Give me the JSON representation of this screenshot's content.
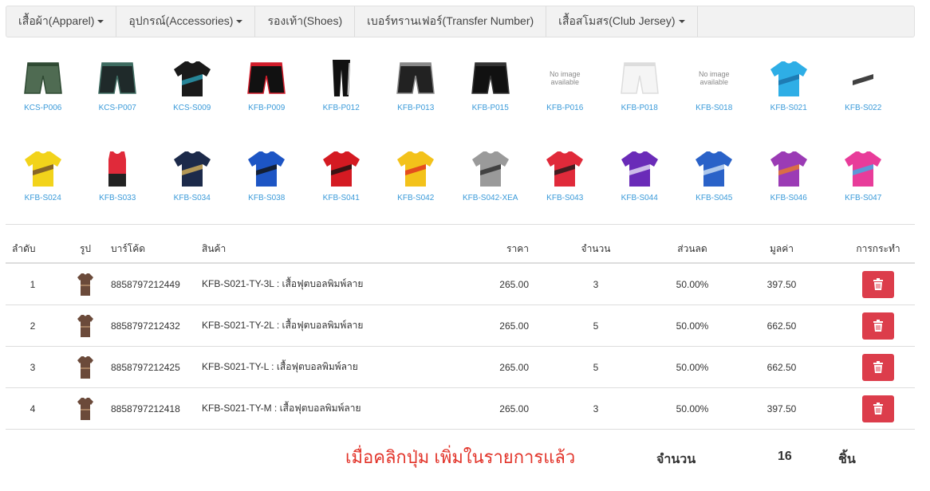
{
  "nav": {
    "items": [
      {
        "label": "เสื้อผ้า(Apparel)",
        "dropdown": true
      },
      {
        "label": "อุปกรณ์(Accessories)",
        "dropdown": true
      },
      {
        "label": "รองเท้า(Shoes)",
        "dropdown": false
      },
      {
        "label": "เบอร์ทรานเฟอร์(Transfer Number)",
        "dropdown": false
      },
      {
        "label": "เสื้อสโมสร(Club Jersey)",
        "dropdown": true
      }
    ]
  },
  "no_image_text": "No image available",
  "products_row1": [
    {
      "code": "KCS-P006",
      "kind": "shorts",
      "color": "#4f6b52",
      "accent": "#2f4a33"
    },
    {
      "code": "KCS-P007",
      "kind": "shorts",
      "color": "#1f2a2a",
      "accent": "#3d6b60"
    },
    {
      "code": "KCS-S009",
      "kind": "shirt",
      "color": "#1a1a1a",
      "accent": "#2aa0b8"
    },
    {
      "code": "KFB-P009",
      "kind": "shorts",
      "color": "#111111",
      "accent": "#d01c2a"
    },
    {
      "code": "KFB-P012",
      "kind": "pants",
      "color": "#111111",
      "accent": "#ffffff"
    },
    {
      "code": "KFB-P013",
      "kind": "shorts",
      "color": "#222222",
      "accent": "#888888"
    },
    {
      "code": "KFB-P015",
      "kind": "shorts",
      "color": "#111111",
      "accent": "#333333"
    },
    {
      "code": "KFB-P016",
      "kind": "none",
      "color": "",
      "accent": ""
    },
    {
      "code": "KFB-P018",
      "kind": "shorts",
      "color": "#f5f5f5",
      "accent": "#dddddd"
    },
    {
      "code": "KFB-S018",
      "kind": "none",
      "color": "",
      "accent": ""
    },
    {
      "code": "KFB-S021",
      "kind": "shirt",
      "color": "#2eaee6",
      "accent": "#1a6fa8"
    },
    {
      "code": "KFB-S022",
      "kind": "shirt",
      "color": "#ffffff",
      "accent": "#111111"
    }
  ],
  "products_row2": [
    {
      "code": "KFB-S024",
      "kind": "shirt",
      "color": "#f2d31b",
      "accent": "#6b4a2a"
    },
    {
      "code": "KFB-S033",
      "kind": "tank",
      "color": "#e02a3a",
      "accent": "#222222"
    },
    {
      "code": "KFB-S034",
      "kind": "shirt",
      "color": "#1c2a4a",
      "accent": "#d9b45a"
    },
    {
      "code": "KFB-S038",
      "kind": "shirt",
      "color": "#1d55c4",
      "accent": "#111111"
    },
    {
      "code": "KFB-S041",
      "kind": "shirt",
      "color": "#d41a22",
      "accent": "#111111"
    },
    {
      "code": "KFB-S042",
      "kind": "shirt",
      "color": "#f3c21a",
      "accent": "#e0301e"
    },
    {
      "code": "KFB-S042-XEA",
      "kind": "shirt",
      "color": "#9a9a9a",
      "accent": "#2a2a2a"
    },
    {
      "code": "KFB-S043",
      "kind": "shirt",
      "color": "#e02a3a",
      "accent": "#1a1a1a"
    },
    {
      "code": "KFB-S044",
      "kind": "shirt",
      "color": "#6a2bb8",
      "accent": "#e6e0f5"
    },
    {
      "code": "KFB-S045",
      "kind": "shirt",
      "color": "#2a62c8",
      "accent": "#cfe2f5"
    },
    {
      "code": "KFB-S046",
      "kind": "shirt",
      "color": "#9b3bb5",
      "accent": "#e87a2a"
    },
    {
      "code": "KFB-S047",
      "kind": "shirt",
      "color": "#e83c9a",
      "accent": "#3ab0e6"
    }
  ],
  "table": {
    "headers": {
      "index": "ลำดับ",
      "image": "รูป",
      "barcode": "บาร์โค้ด",
      "product": "สินค้า",
      "price": "ราคา",
      "quantity": "จำนวน",
      "discount": "ส่วนลด",
      "total": "มูลค่า",
      "action": "การกระทำ"
    },
    "rows": [
      {
        "index": "1",
        "barcode": "8858797212449",
        "product": "KFB-S021-TY-3L : เสื้อฟุตบอลพิมพ์ลาย",
        "price": "265.00",
        "quantity": "3",
        "discount": "50.00%",
        "total": "397.50"
      },
      {
        "index": "2",
        "barcode": "8858797212432",
        "product": "KFB-S021-TY-2L : เสื้อฟุตบอลพิมพ์ลาย",
        "price": "265.00",
        "quantity": "5",
        "discount": "50.00%",
        "total": "662.50"
      },
      {
        "index": "3",
        "barcode": "8858797212425",
        "product": "KFB-S021-TY-L : เสื้อฟุตบอลพิมพ์ลาย",
        "price": "265.00",
        "quantity": "5",
        "discount": "50.00%",
        "total": "662.50"
      },
      {
        "index": "4",
        "barcode": "8858797212418",
        "product": "KFB-S021-TY-M : เสื้อฟุตบอลพิมพ์ลาย",
        "price": "265.00",
        "quantity": "3",
        "discount": "50.00%",
        "total": "397.50"
      }
    ],
    "row_shirt_color": "#6b4a3a",
    "delete_color": "#dc3d4b"
  },
  "summary": {
    "notice": "เมื่อคลิกปุ่ม เพิ่มในรายการแล้ว",
    "label": "จำนวน",
    "value": "16",
    "unit": "ชิ้น"
  }
}
